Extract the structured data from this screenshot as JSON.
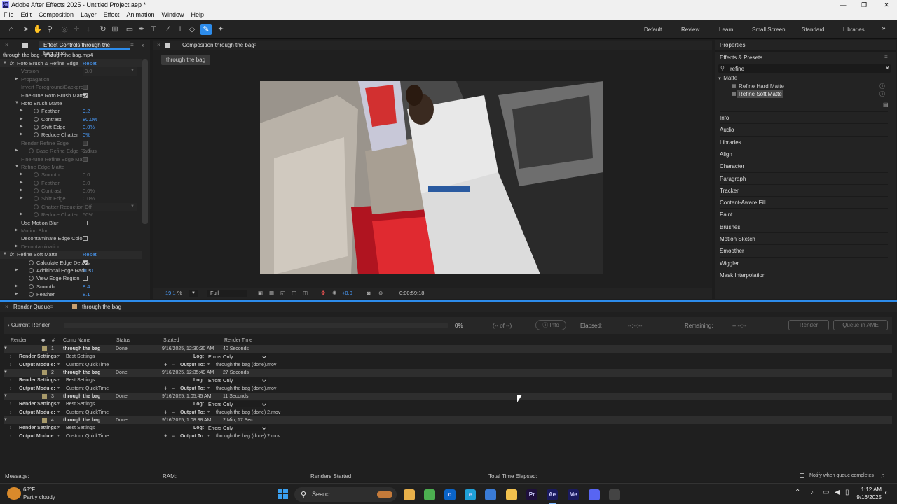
{
  "app": {
    "title": "Adobe After Effects 2025 - Untitled Project.aep *",
    "icon": "Ae"
  },
  "window_controls": {
    "minimize": "—",
    "restore": "❐",
    "close": "✕"
  },
  "menu": [
    "File",
    "Edit",
    "Composition",
    "Layer",
    "Effect",
    "Animation",
    "Window",
    "Help"
  ],
  "workspaces": [
    "Default",
    "Review",
    "Learn",
    "Small Screen",
    "Standard",
    "Libraries"
  ],
  "effect_controls": {
    "tab": "Effect Controls through the bag.mp4",
    "breadcrumb": "through the bag - through the bag.mp4",
    "rows": [
      {
        "label": "Roto Brush & Refine Edge",
        "fx": true,
        "value": "Reset",
        "indent": 0
      },
      {
        "label": "Version",
        "value": "3.0",
        "dim": true,
        "dropdown": true,
        "indent": 1
      },
      {
        "label": "Propagation",
        "dim": true,
        "twirl": true,
        "indent": 1
      },
      {
        "label": "Invert Foreground/Backgrou",
        "dim": true,
        "check": "disabled",
        "indent": 1
      },
      {
        "label": "Fine-tune Roto Brush Matte",
        "check": "on",
        "indent": 1
      },
      {
        "label": "Roto Brush Matte",
        "twirl": true,
        "open": true,
        "indent": 1
      },
      {
        "label": "Feather",
        "value": "9.2",
        "twirl": true,
        "sw": true,
        "indent": 2
      },
      {
        "label": "Contrast",
        "value": "80.0%",
        "twirl": true,
        "sw": true,
        "indent": 2
      },
      {
        "label": "Shift Edge",
        "value": "0.0%",
        "twirl": true,
        "sw": true,
        "indent": 2
      },
      {
        "label": "Reduce Chatter",
        "value": "0%",
        "twirl": true,
        "sw": true,
        "indent": 2
      },
      {
        "label": "Render Refine Edge",
        "dim": true,
        "check": "disabled",
        "indent": 1
      },
      {
        "label": "Base Refine Edge Radius",
        "value": "0.0",
        "dim": true,
        "twirl": true,
        "sw": true,
        "indent": 1
      },
      {
        "label": "Fine-tune Refine Edge Matte",
        "dim": true,
        "check": "disabled",
        "indent": 1
      },
      {
        "label": "Refine Edge Matte",
        "dim": true,
        "twirl": true,
        "open": true,
        "indent": 1
      },
      {
        "label": "Smooth",
        "value": "0.0",
        "dim": true,
        "twirl": true,
        "sw": true,
        "indent": 2
      },
      {
        "label": "Feather",
        "value": "0.0",
        "dim": true,
        "twirl": true,
        "sw": true,
        "indent": 2
      },
      {
        "label": "Contrast",
        "value": "0.0%",
        "dim": true,
        "twirl": true,
        "sw": true,
        "indent": 2
      },
      {
        "label": "Shift Edge",
        "value": "0.0%",
        "dim": true,
        "twirl": true,
        "sw": true,
        "indent": 2
      },
      {
        "label": "Chatter Reduction",
        "value": "Off",
        "dim": true,
        "dropdown": true,
        "sw": true,
        "indent": 2
      },
      {
        "label": "Reduce Chatter",
        "value": "50%",
        "dim": true,
        "twirl": true,
        "sw": true,
        "indent": 2
      },
      {
        "label": "Use Motion Blur",
        "check": "off",
        "indent": 1
      },
      {
        "label": "Motion Blur",
        "dim": true,
        "twirl": true,
        "indent": 1
      },
      {
        "label": "Decontaminate Edge Colors",
        "check": "off",
        "indent": 1
      },
      {
        "label": "Decontamination",
        "dim": true,
        "twirl": true,
        "indent": 1
      },
      {
        "label": "Refine Soft Matte",
        "fx": true,
        "value": "Reset",
        "indent": 0
      },
      {
        "label": "Calculate Edge Details",
        "check": "on",
        "sw": true,
        "indent": 1
      },
      {
        "label": "Additional Edge Radius",
        "value": "10.0",
        "twirl": true,
        "sw": true,
        "indent": 1
      },
      {
        "label": "View Edge Region",
        "check": "off",
        "sw": true,
        "indent": 1
      },
      {
        "label": "Smooth",
        "value": "8.4",
        "twirl": true,
        "sw": true,
        "indent": 1
      },
      {
        "label": "Feather",
        "value": "8.1",
        "twirl": true,
        "sw": true,
        "indent": 1
      }
    ]
  },
  "composition": {
    "tab": "Composition through the bag",
    "subtab": "through the bag",
    "zoom": "19.1",
    "zoom_unit": "%",
    "resolution": "Full",
    "exposure": "+0.0",
    "timecode": "0:00:59:18"
  },
  "right_panel": {
    "properties": "Properties",
    "effects_presets": "Effects & Presets",
    "search_value": "refine",
    "category": "Matte",
    "results": [
      "Refine Hard Matte",
      "Refine Soft Matte"
    ],
    "panels": [
      "Info",
      "Audio",
      "Libraries",
      "Align",
      "Character",
      "Paragraph",
      "Tracker",
      "Content-Aware Fill",
      "Paint",
      "Brushes",
      "Motion Sketch",
      "Smoother",
      "Wiggler",
      "Mask Interpolation"
    ]
  },
  "render_queue": {
    "tab": "Render Queue",
    "comp_tab": "through the bag",
    "current_render": "Current Render",
    "percent": "0%",
    "of": "(-- of --)",
    "info_button": "Info",
    "elapsed_label": "Elapsed:",
    "elapsed": "--:--:--",
    "remaining_label": "Remaining:",
    "remaining": "--:--:--",
    "render_button": "Render",
    "ame_button": "Queue in AME",
    "headers": {
      "render": "Render",
      "num": "#",
      "comp": "Comp Name",
      "status": "Status",
      "started": "Started",
      "time": "Render Time"
    },
    "labels": {
      "render_settings": "Render Settings:",
      "output_module": "Output Module:",
      "log": "Log:",
      "output_to": "Output To:"
    },
    "items": [
      {
        "num": "1",
        "comp": "through the bag",
        "status": "Done",
        "started": "9/16/2025, 12:30:30 AM",
        "time": "40 Seconds",
        "settings": "Best Settings",
        "module": "Custom: QuickTime",
        "log": "Errors Only",
        "output": "through the bag (done).mov"
      },
      {
        "num": "2",
        "comp": "through the bag",
        "status": "Done",
        "started": "9/16/2025, 12:35:49 AM",
        "time": "27 Seconds",
        "settings": "Best Settings",
        "module": "Custom: QuickTime",
        "log": "Errors Only",
        "output": "through the bag (done).mov"
      },
      {
        "num": "3",
        "comp": "through the bag",
        "status": "Done",
        "started": "9/16/2025, 1:05:45 AM",
        "time": "11 Seconds",
        "settings": "Best Settings",
        "module": "Custom: QuickTime",
        "log": "Errors Only",
        "output": "through the bag (done) 2.mov"
      },
      {
        "num": "4",
        "comp": "through the bag",
        "status": "Done",
        "started": "9/16/2025, 1:08:38 AM",
        "time": "2 Min, 17 Sec",
        "settings": "Best Settings",
        "module": "Custom: QuickTime",
        "log": "Errors Only",
        "output": "through the bag (done) 2.mov"
      }
    ],
    "footer": {
      "message": "Message:",
      "ram": "RAM:",
      "renders_started": "Renders Started:",
      "total_time": "Total Time Elapsed:",
      "notify": "Notify when queue completes"
    }
  },
  "taskbar": {
    "weather_temp": "68°F",
    "weather_desc": "Partly cloudy",
    "search": "Search",
    "time": "1:12 AM",
    "date": "9/16/2025",
    "apps": [
      {
        "name": "file-explorer-icon",
        "label": "",
        "color": "#e8b04a"
      },
      {
        "name": "chrome-icon",
        "label": "",
        "color": "#4caf50"
      },
      {
        "name": "outlook-icon",
        "label": "o",
        "color": "#0a64c8"
      },
      {
        "name": "edge-icon",
        "label": "e",
        "color": "#1fa0d8"
      },
      {
        "name": "store-icon",
        "label": "",
        "color": "#3a7bd5"
      },
      {
        "name": "folder-icon",
        "label": "",
        "color": "#f2c14e"
      },
      {
        "name": "premiere-icon",
        "label": "Pr",
        "color": "#1e0f3c"
      },
      {
        "name": "after-effects-icon",
        "label": "Ae",
        "color": "#1a1a5e"
      },
      {
        "name": "media-encoder-icon",
        "label": "Me",
        "color": "#1a1a5e"
      },
      {
        "name": "discord-icon",
        "label": "",
        "color": "#5865f2"
      },
      {
        "name": "misc-icon",
        "label": "",
        "color": "#444"
      }
    ]
  }
}
